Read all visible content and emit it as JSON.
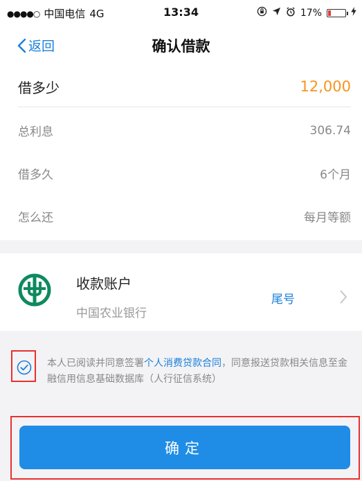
{
  "status_bar": {
    "signal": "●●●●○",
    "carrier": "中国电信",
    "network": "4G",
    "time": "13:34",
    "battery_percent": "17%",
    "battery_level": 0.17,
    "battery_color": "#e53935"
  },
  "nav": {
    "back_label": "返回",
    "title": "确认借款"
  },
  "loan": {
    "amount_label": "借多少",
    "amount_value": "12,000",
    "interest_label": "总利息",
    "interest_value": "306.74",
    "duration_label": "借多久",
    "duration_value": "6个月",
    "repay_label": "怎么还",
    "repay_value": "每月等额"
  },
  "account": {
    "title": "收款账户",
    "bank_name": "中国农业银行",
    "tail_label": "尾号",
    "logo_icon": "abc-bank-logo-icon"
  },
  "agreement": {
    "text_before": "本人已阅读并同意签署",
    "link_text": "个人消费贷款合同",
    "text_after": "，同意报送贷款相关信息至金融信用信息基础数据库（人行征信系统）",
    "checked": true
  },
  "confirm_button": {
    "label": "确定"
  },
  "colors": {
    "accent": "#1a7fd9",
    "button": "#1f8de6",
    "amount": "#f7941d",
    "highlight_box": "#e8302f",
    "bank_green": "#0e8a5f"
  }
}
